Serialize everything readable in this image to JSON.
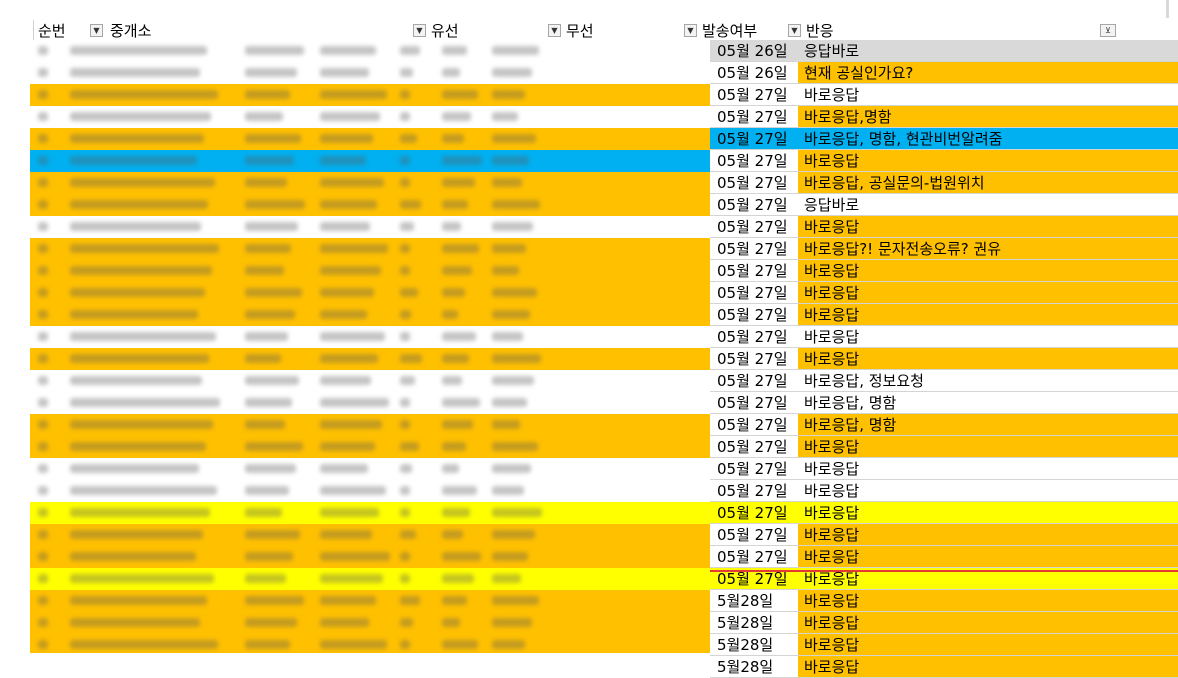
{
  "columns": {
    "seq": "순번",
    "agency": "중개소",
    "wired": "유선",
    "wireless": "무선",
    "sent": "발송여부",
    "response": "반응"
  },
  "colors": {
    "orange": "#FFC000",
    "gray": "#D9D9D9",
    "white": "#FFFFFF",
    "blue": "#00B0F0",
    "yellow": "#FFFF00",
    "red_divider": "#E53935"
  },
  "rows": [
    {
      "date": "05월 26일",
      "response": "응답바로",
      "color": "#D9D9D9",
      "date_color": "#D9D9D9"
    },
    {
      "date": "05월 26일",
      "response": "현재 공실인가요?",
      "color": "#FFC000",
      "date_color": "#FFFFFF"
    },
    {
      "date": "05월 27일",
      "response": "바로응답",
      "color": "#FFFFFF",
      "date_color": "#FFFFFF"
    },
    {
      "date": "05월 27일",
      "response": "바로응답,명함",
      "color": "#FFC000",
      "date_color": "#FFFFFF"
    },
    {
      "date": "05월 27일",
      "response": "바로응답, 명함, 현관비번알려줌",
      "color": "#00B0F0",
      "date_color": "#00B0F0"
    },
    {
      "date": "05월 27일",
      "response": "바로응답",
      "color": "#FFC000",
      "date_color": "#FFFFFF"
    },
    {
      "date": "05월 27일",
      "response": "바로응답, 공실문의-법원위치",
      "color": "#FFC000",
      "date_color": "#FFFFFF"
    },
    {
      "date": "05월 27일",
      "response": "응답바로",
      "color": "#FFFFFF",
      "date_color": "#FFFFFF"
    },
    {
      "date": "05월 27일",
      "response": "바로응답",
      "color": "#FFC000",
      "date_color": "#FFFFFF"
    },
    {
      "date": "05월 27일",
      "response": "바로응답?! 문자전송오류? 권유",
      "color": "#FFC000",
      "date_color": "#FFFFFF"
    },
    {
      "date": "05월 27일",
      "response": "바로응답",
      "color": "#FFC000",
      "date_color": "#FFFFFF"
    },
    {
      "date": "05월 27일",
      "response": "바로응답",
      "color": "#FFC000",
      "date_color": "#FFFFFF"
    },
    {
      "date": "05월 27일",
      "response": "바로응답",
      "color": "#FFC000",
      "date_color": "#FFFFFF"
    },
    {
      "date": "05월 27일",
      "response": "바로응답",
      "color": "#FFFFFF",
      "date_color": "#FFFFFF"
    },
    {
      "date": "05월 27일",
      "response": "바로응답",
      "color": "#FFC000",
      "date_color": "#FFFFFF"
    },
    {
      "date": "05월 27일",
      "response": "바로응답, 정보요청",
      "color": "#FFFFFF",
      "date_color": "#FFFFFF"
    },
    {
      "date": "05월 27일",
      "response": "바로응답, 명함",
      "color": "#FFFFFF",
      "date_color": "#FFFFFF"
    },
    {
      "date": "05월 27일",
      "response": "바로응답, 명함",
      "color": "#FFC000",
      "date_color": "#FFFFFF"
    },
    {
      "date": "05월 27일",
      "response": "바로응답",
      "color": "#FFC000",
      "date_color": "#FFFFFF"
    },
    {
      "date": "05월 27일",
      "response": "바로응답",
      "color": "#FFFFFF",
      "date_color": "#FFFFFF"
    },
    {
      "date": "05월 27일",
      "response": "바로응답",
      "color": "#FFFFFF",
      "date_color": "#FFFFFF"
    },
    {
      "date": "05월 27일",
      "response": "바로응답",
      "color": "#FFFF00",
      "date_color": "#FFFF00"
    },
    {
      "date": "05월 27일",
      "response": "바로응답",
      "color": "#FFC000",
      "date_color": "#FFFFFF"
    },
    {
      "date": "05월 27일",
      "response": "바로응답",
      "color": "#FFC000",
      "date_color": "#FFFFFF"
    },
    {
      "date": "05월 27일",
      "response": "바로응답",
      "color": "#FFFF00",
      "date_color": "#FFFF00"
    },
    {
      "date": "5월28일",
      "response": "바로응답",
      "color": "#FFC000",
      "date_color": "#FFFFFF"
    },
    {
      "date": "5월28일",
      "response": "바로응답",
      "color": "#FFC000",
      "date_color": "#FFFFFF"
    },
    {
      "date": "5월28일",
      "response": "바로응답",
      "color": "#FFC000",
      "date_color": "#FFFFFF"
    },
    {
      "date": "5월28일",
      "response": "바로응답",
      "color": "#FFC000",
      "date_color": "#FFFFFF"
    }
  ],
  "left_row_colors": [
    "#FFFFFF",
    "#FFFFFF",
    "#FFC000",
    "#FFFFFF",
    "#FFC000",
    "#00B0F0",
    "#FFC000",
    "#FFC000",
    "#FFFFFF",
    "#FFC000",
    "#FFC000",
    "#FFC000",
    "#FFC000",
    "#FFFFFF",
    "#FFC000",
    "#FFFFFF",
    "#FFFFFF",
    "#FFC000",
    "#FFC000",
    "#FFFFFF",
    "#FFFFFF",
    "#FFFF00",
    "#FFC000",
    "#FFC000",
    "#FFFF00",
    "#FFC000",
    "#FFC000",
    "#FFC000",
    "#FFC000"
  ],
  "icons": {
    "filter_dropdown": "chevron-down-icon",
    "filter_active": "filter-icon"
  }
}
